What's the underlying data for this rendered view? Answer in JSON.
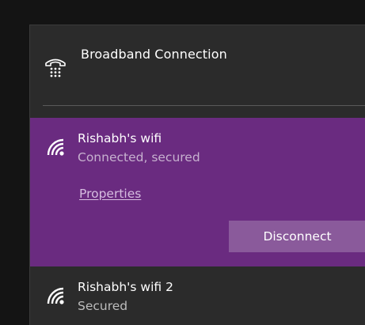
{
  "wired": {
    "label": "Broadband Connection",
    "icon": "dialup-phone-icon"
  },
  "networks": [
    {
      "name": "Rishabh's wifi",
      "status": "Connected, secured",
      "properties_label": "Properties",
      "action_label": "Disconnect",
      "icon": "wifi-signal-icon",
      "selected": true
    },
    {
      "name": "Rishabh's wifi 2",
      "status": "Secured",
      "icon": "wifi-signal-icon",
      "selected": false
    }
  ],
  "colors": {
    "accent": "#6a2b80",
    "button": "#8a5a9b",
    "panel": "#2b2b2b",
    "background": "#141414"
  }
}
